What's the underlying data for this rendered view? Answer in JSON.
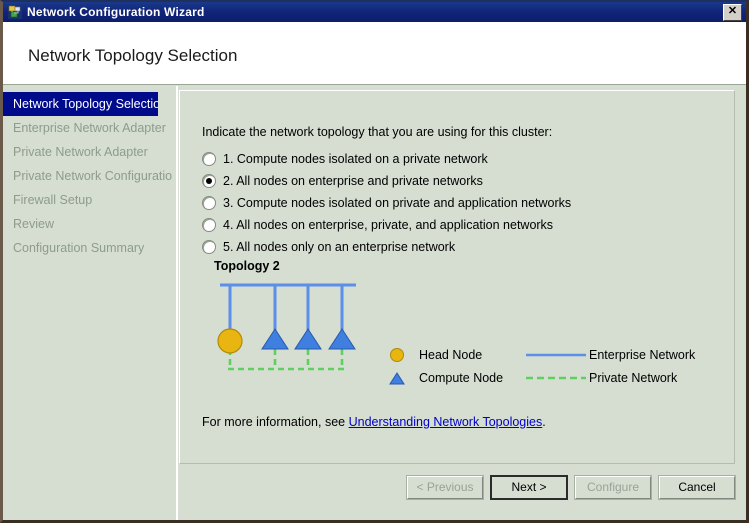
{
  "window": {
    "title": "Network Configuration Wizard",
    "icon": "network-wizard-icon",
    "close_label": "✕"
  },
  "header": {
    "title": "Network Topology Selection"
  },
  "sidebar": {
    "items": [
      {
        "label": "Network Topology Selection",
        "active": true
      },
      {
        "label": "Enterprise Network Adapter",
        "active": false
      },
      {
        "label": "Private Network Adapter",
        "active": false
      },
      {
        "label": "Private Network Configuration",
        "active": false
      },
      {
        "label": "Firewall Setup",
        "active": false
      },
      {
        "label": "Review",
        "active": false
      },
      {
        "label": "Configuration Summary",
        "active": false
      }
    ]
  },
  "main": {
    "prompt": "Indicate the network topology that you are using for this cluster:",
    "options": [
      {
        "label": "1. Compute nodes isolated on a private network",
        "selected": false
      },
      {
        "label": "2. All nodes on enterprise and private networks",
        "selected": true
      },
      {
        "label": "3. Compute nodes isolated on private and application networks",
        "selected": false
      },
      {
        "label": "4. All nodes on enterprise, private, and application networks",
        "selected": false
      },
      {
        "label": "5. All nodes only on an enterprise network",
        "selected": false
      }
    ],
    "topology": {
      "title": "Topology 2",
      "head_node_color": "#e8b511",
      "compute_node_color": "#3f7fe0",
      "enterprise_line_color": "#5b8fe8",
      "private_line_color": "#5fcf5f",
      "head_node_count": 1,
      "compute_node_count": 3
    },
    "legend": {
      "left": [
        {
          "glyph": "head-node-circle",
          "label": "Head Node"
        },
        {
          "glyph": "compute-node-triangle",
          "label": "Compute Node"
        }
      ],
      "right": [
        {
          "glyph": "solid-blue-line",
          "label": "Enterprise Network"
        },
        {
          "glyph": "dashed-green-line",
          "label": "Private Network"
        }
      ]
    },
    "more_info": {
      "prefix": "For more information, see ",
      "link_text": "Understanding Network Topologies",
      "suffix": "."
    }
  },
  "buttons": [
    {
      "label": "< Previous",
      "disabled": true,
      "default": false
    },
    {
      "label": "Next >",
      "disabled": false,
      "default": true
    },
    {
      "label": "Configure",
      "disabled": true,
      "default": false
    },
    {
      "label": "Cancel",
      "disabled": false,
      "default": false
    }
  ]
}
